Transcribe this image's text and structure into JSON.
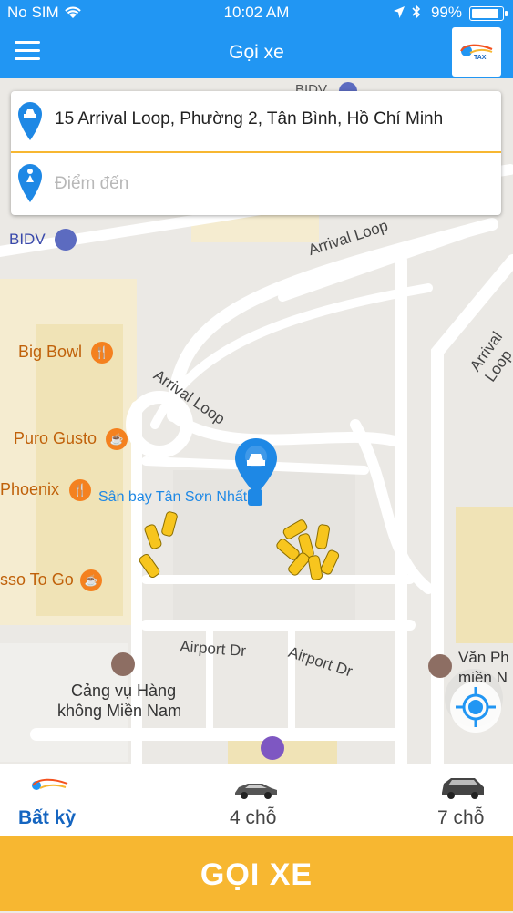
{
  "status_bar": {
    "carrier": "No SIM",
    "time": "10:02 AM",
    "battery": "99%",
    "wifi_icon": "wifi-icon",
    "location_icon": "location-arrow-icon",
    "bluetooth_icon": "bluetooth-icon",
    "battery_level": 0.99
  },
  "nav": {
    "title": "Gọi xe",
    "menu_icon": "hamburger-menu-icon",
    "logo_text": "TAXI"
  },
  "address": {
    "origin": "15 Arrival Loop, Phường 2, Tân Bình, Hồ Chí Minh",
    "destination_placeholder": "Điểm đến",
    "destination_value": ""
  },
  "map": {
    "labels": {
      "bidv_top": "BIDV",
      "bidv": "BIDV",
      "arrival_loop_1": "Arrival Loop",
      "arrival_loop_2": "Arrival Loop",
      "arrival_loop_3": "Arrival Loop",
      "big_bowl": "Big Bowl",
      "puro_gusto": "Puro Gusto",
      "phoenix": "Phoenix",
      "airport_station": "Sân bay Tân Sơn Nhất",
      "espresso": "sso To Go",
      "airport_dr_1": "Airport Dr",
      "airport_dr_2": "Airport Dr",
      "port_line1": "Cảng vụ Hàng",
      "port_line2": "không Miền Nam",
      "office_line1": "Văn Ph",
      "office_line2": "miền N"
    }
  },
  "vehicle_options": [
    {
      "label": "Bất kỳ",
      "selected": true
    },
    {
      "label": "4 chỗ",
      "selected": false
    },
    {
      "label": "7 chỗ",
      "selected": false
    }
  ],
  "call_button": "GỌI XE",
  "colors": {
    "primary": "#2196f3",
    "accent": "#f7b731",
    "selected": "#1565c0"
  }
}
